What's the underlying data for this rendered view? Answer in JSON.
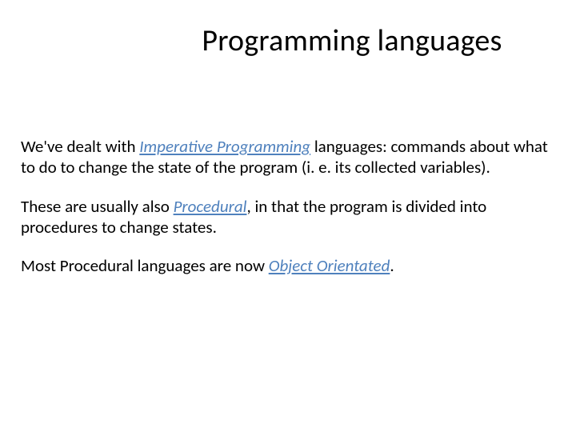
{
  "title": "Programming languages",
  "para1": {
    "t1": "We've dealt with ",
    "term": "Imperative Programming",
    "t2": " languages: commands about what to do to change the state of the program (i. e. its collected variables)."
  },
  "para2": {
    "t1": "These are usually also ",
    "term": "Procedural",
    "t2": ", in that the program is divided into procedures to change states."
  },
  "para3": {
    "t1": "Most Procedural languages are now ",
    "term": "Object Orientated",
    "t2": "."
  }
}
